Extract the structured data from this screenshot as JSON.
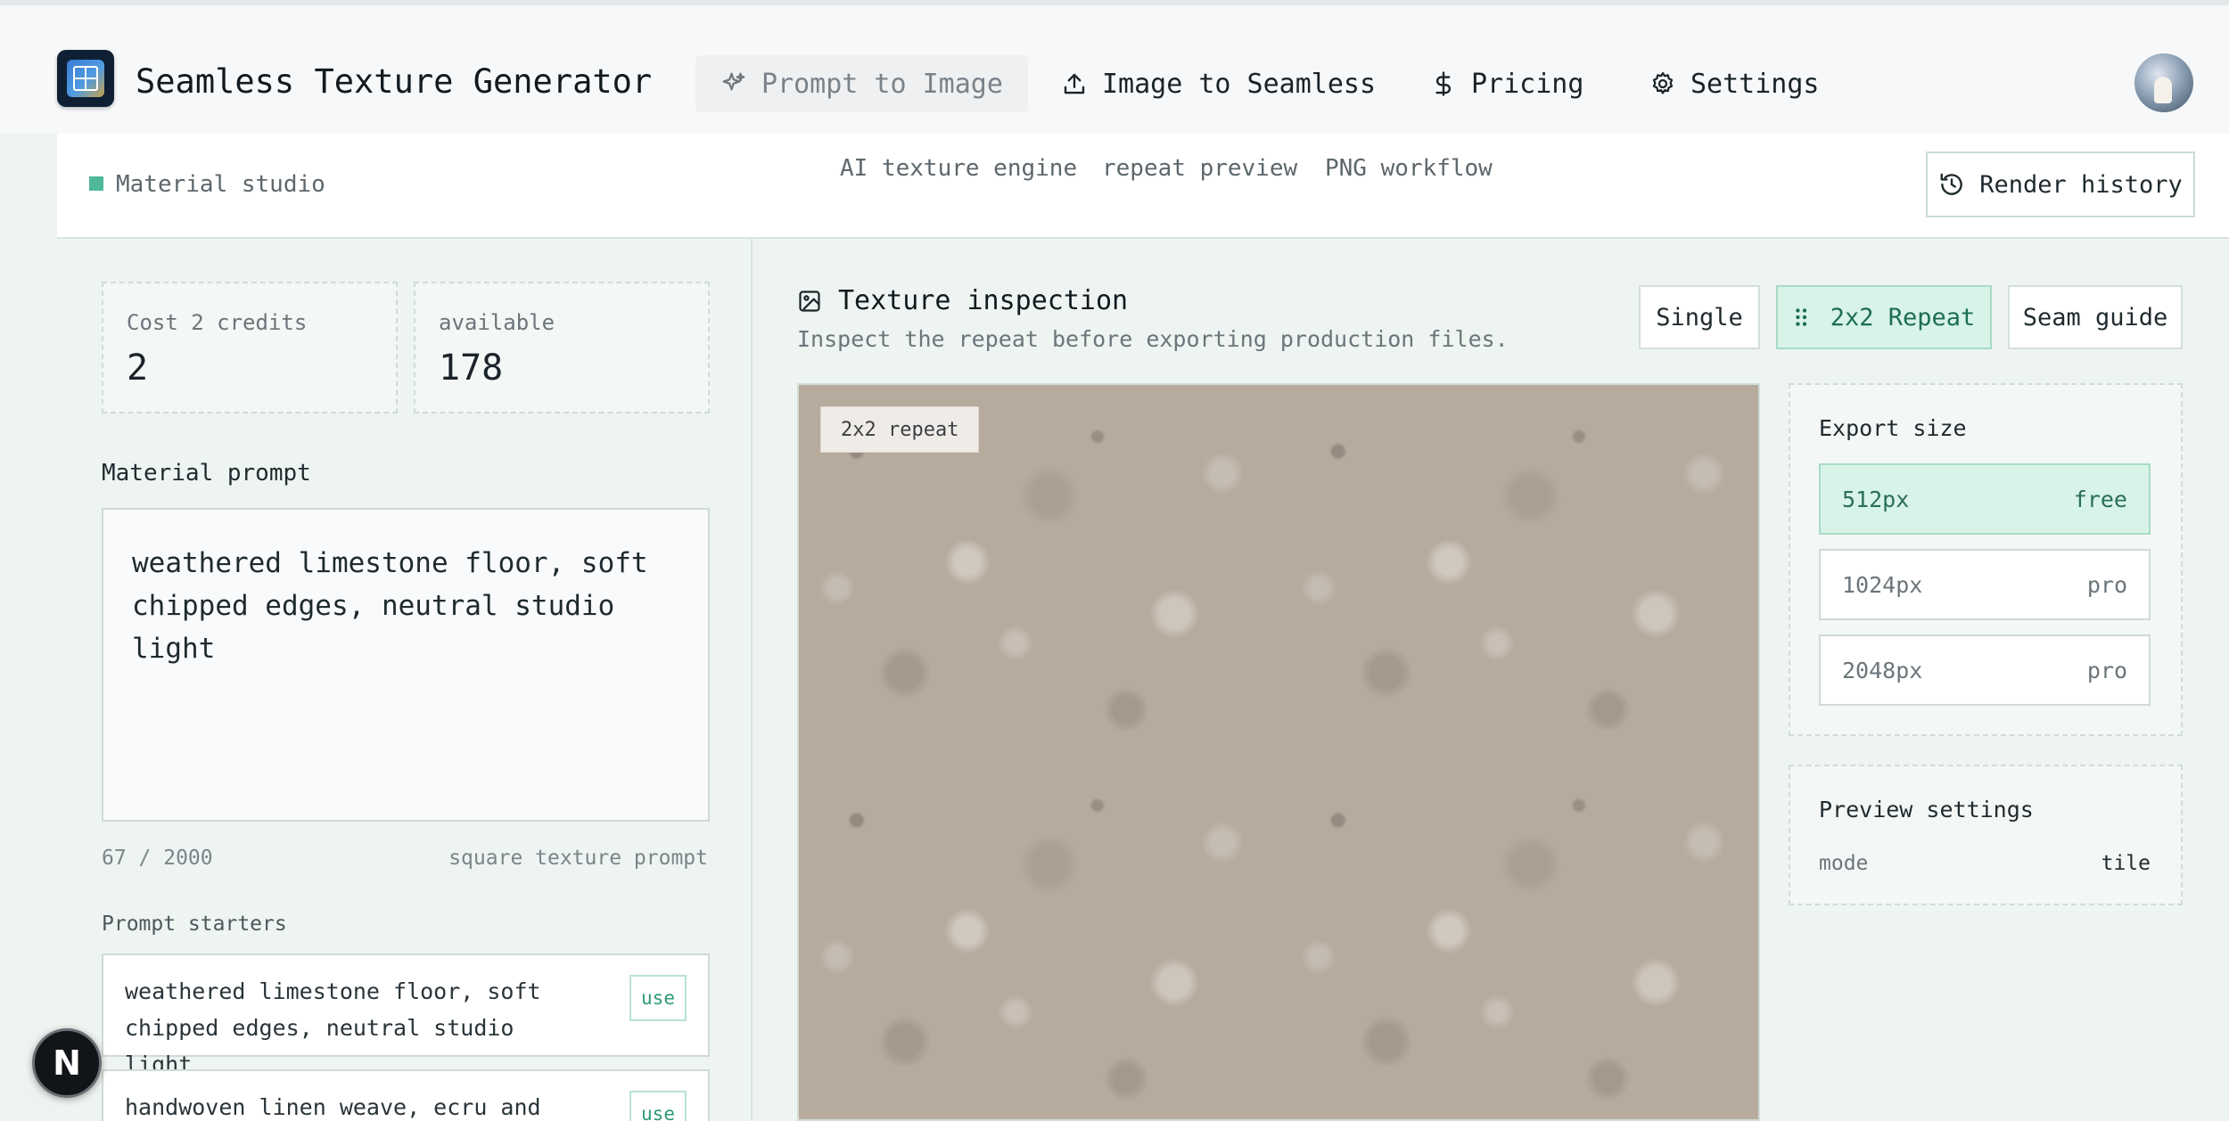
{
  "app": {
    "title": "Seamless Texture Generator"
  },
  "nav": [
    {
      "label": "Prompt to Image",
      "icon": "sparkles-icon",
      "active": true
    },
    {
      "label": "Image to Seamless",
      "icon": "upload-icon",
      "active": false
    },
    {
      "label": "Pricing",
      "icon": "dollar-icon",
      "active": false
    },
    {
      "label": "Settings",
      "icon": "gear-icon",
      "active": false
    }
  ],
  "subheader": {
    "studio": "Material studio",
    "tags": [
      "AI texture engine",
      "repeat preview",
      "PNG workflow"
    ],
    "history_label": "Render history"
  },
  "stats": {
    "cost_label": "Cost 2 credits",
    "cost_value": "2",
    "available_label": "available",
    "available_value": "178"
  },
  "prompt": {
    "label": "Material prompt",
    "value": "weathered limestone floor, soft chipped edges, neutral studio light",
    "count": "67 / 2000",
    "hint": "square texture prompt"
  },
  "starters": {
    "label": "Prompt starters",
    "items": [
      {
        "text": "weathered limestone floor, soft chipped edges, neutral studio light",
        "action": "use"
      },
      {
        "text": "handwoven linen weave, ecru and",
        "action": "use"
      }
    ]
  },
  "inspection": {
    "title": "Texture inspection",
    "subtitle": "Inspect the repeat before exporting production files.",
    "modes": [
      "Single",
      "2x2 Repeat",
      "Seam guide"
    ],
    "active_mode": "2x2 Repeat",
    "preview_chip": "2x2 repeat"
  },
  "export": {
    "title": "Export size",
    "options": [
      {
        "size": "512px",
        "tier": "free",
        "selected": true
      },
      {
        "size": "1024px",
        "tier": "pro",
        "selected": false
      },
      {
        "size": "2048px",
        "tier": "pro",
        "selected": false
      }
    ]
  },
  "preview_settings": {
    "title": "Preview settings",
    "mode_label": "mode",
    "mode_value": "tile"
  },
  "badge": {
    "letter": "N"
  },
  "colors": {
    "accent": "#4fb89a",
    "accent_bg": "#d8f3e8",
    "accent_text": "#2e9b78"
  }
}
